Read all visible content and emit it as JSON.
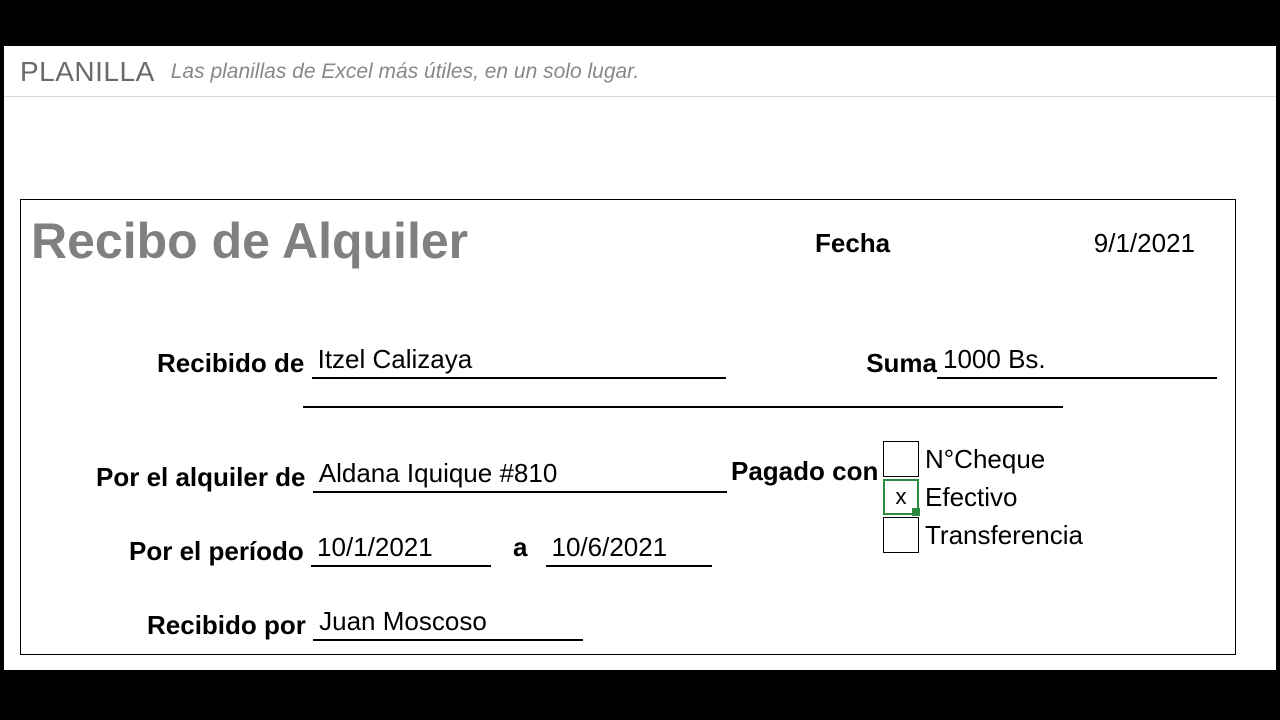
{
  "site": {
    "title": "PLANILLA",
    "tagline": "Las planillas de Excel más útiles, en un solo lugar."
  },
  "receipt": {
    "title": "Recibo de Alquiler",
    "date_label": "Fecha",
    "date": "9/1/2021",
    "recibido_de_label": "Recibido de",
    "recibido_de": "Itzel Calizaya",
    "suma_label": "Suma",
    "suma": "1000 Bs.",
    "alquiler_de_label": "Por el alquiler de",
    "alquiler_de": "Aldana Iquique #810",
    "periodo_label": "Por el período",
    "periodo_start": "10/1/2021",
    "periodo_sep": "a",
    "periodo_end": "10/6/2021",
    "recibido_por_label": "Recibido por",
    "recibido_por": "Juan Moscoso",
    "pagado_con_label": "Pagado con",
    "pay_options": {
      "cheque": "N°Cheque",
      "efectivo": "Efectivo",
      "transferencia": "Transferencia"
    },
    "efectivo_mark": "x"
  }
}
